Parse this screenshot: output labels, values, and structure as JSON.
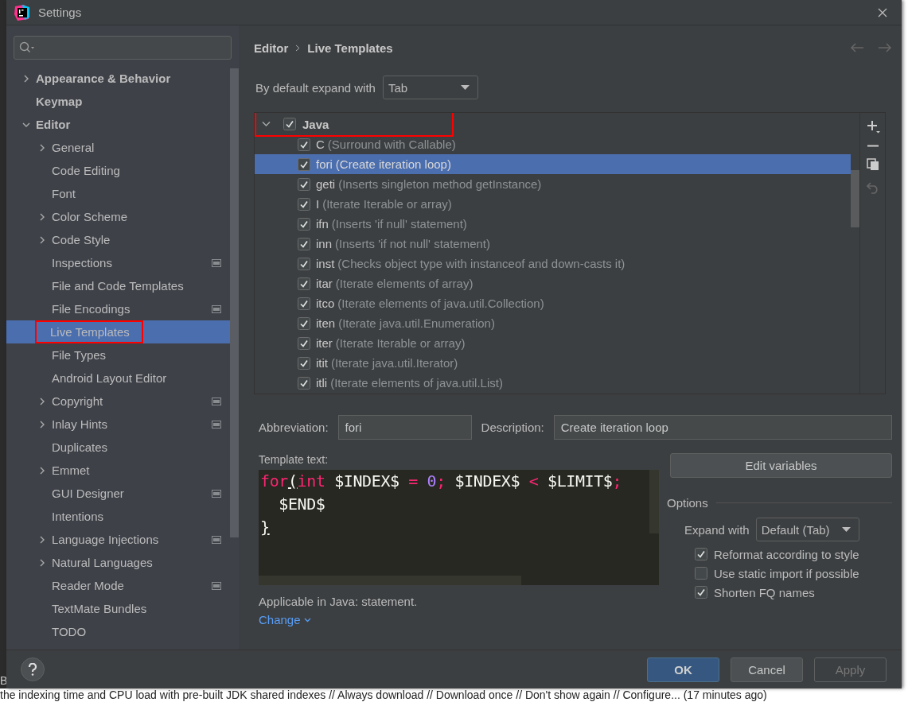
{
  "window": {
    "title": "Settings"
  },
  "sidebar": {
    "items": [
      {
        "label": "Appearance & Behavior",
        "expanded": false,
        "badge": false,
        "selected": false,
        "annotated": false
      },
      {
        "label": "Keymap",
        "badge": false,
        "selected": false,
        "annotated": false
      },
      {
        "label": "Editor",
        "expanded": true,
        "badge": false,
        "selected": false,
        "annotated": false,
        "children": [
          {
            "label": "General",
            "expanded": false,
            "badge": false,
            "selected": false,
            "annotated": false
          },
          {
            "label": "Code Editing",
            "badge": false,
            "selected": false,
            "annotated": false
          },
          {
            "label": "Font",
            "badge": false,
            "selected": false,
            "annotated": false
          },
          {
            "label": "Color Scheme",
            "expanded": false,
            "badge": false,
            "selected": false,
            "annotated": false
          },
          {
            "label": "Code Style",
            "expanded": false,
            "badge": false,
            "selected": false,
            "annotated": false
          },
          {
            "label": "Inspections",
            "badge": true,
            "selected": false,
            "annotated": false
          },
          {
            "label": "File and Code Templates",
            "badge": false,
            "selected": false,
            "annotated": false
          },
          {
            "label": "File Encodings",
            "badge": true,
            "selected": false,
            "annotated": false
          },
          {
            "label": "Live Templates",
            "badge": false,
            "selected": true,
            "annotated": true
          },
          {
            "label": "File Types",
            "badge": false,
            "selected": false,
            "annotated": false
          },
          {
            "label": "Android Layout Editor",
            "badge": false,
            "selected": false,
            "annotated": false
          },
          {
            "label": "Copyright",
            "expanded": false,
            "badge": true,
            "selected": false,
            "annotated": false
          },
          {
            "label": "Inlay Hints",
            "expanded": false,
            "badge": true,
            "selected": false,
            "annotated": false
          },
          {
            "label": "Duplicates",
            "badge": false,
            "selected": false,
            "annotated": false
          },
          {
            "label": "Emmet",
            "expanded": false,
            "badge": false,
            "selected": false,
            "annotated": false
          },
          {
            "label": "GUI Designer",
            "badge": true,
            "selected": false,
            "annotated": false
          },
          {
            "label": "Intentions",
            "badge": false,
            "selected": false,
            "annotated": false
          },
          {
            "label": "Language Injections",
            "expanded": false,
            "badge": true,
            "selected": false,
            "annotated": false
          },
          {
            "label": "Natural Languages",
            "expanded": false,
            "badge": false,
            "selected": false,
            "annotated": false
          },
          {
            "label": "Reader Mode",
            "badge": true,
            "selected": false,
            "annotated": false
          },
          {
            "label": "TextMate Bundles",
            "badge": false,
            "selected": false,
            "annotated": false
          },
          {
            "label": "TODO",
            "badge": false,
            "selected": false,
            "annotated": false
          }
        ]
      }
    ]
  },
  "breadcrumb": [
    "Editor",
    "Live Templates"
  ],
  "expand_with": {
    "label": "By default expand with",
    "value": "Tab"
  },
  "templates": [
    {
      "label": "Java",
      "checked": true,
      "expanded": true,
      "annotated": true,
      "children": [
        {
          "abbreviation": "C",
          "description": "(Surround with Callable)",
          "checked": true,
          "selected": false
        },
        {
          "abbreviation": "fori",
          "description": "(Create iteration loop)",
          "checked": true,
          "selected": true
        },
        {
          "abbreviation": "geti",
          "description": "(Inserts singleton method getInstance)",
          "checked": true,
          "selected": false
        },
        {
          "abbreviation": "I",
          "description": "(Iterate Iterable or array)",
          "checked": true,
          "selected": false
        },
        {
          "abbreviation": "ifn",
          "description": "(Inserts 'if null' statement)",
          "checked": true,
          "selected": false
        },
        {
          "abbreviation": "inn",
          "description": "(Inserts 'if not null' statement)",
          "checked": true,
          "selected": false
        },
        {
          "abbreviation": "inst",
          "description": "(Checks object type with instanceof and down-casts it)",
          "checked": true,
          "selected": false
        },
        {
          "abbreviation": "itar",
          "description": "(Iterate elements of array)",
          "checked": true,
          "selected": false
        },
        {
          "abbreviation": "itco",
          "description": "(Iterate elements of java.util.Collection)",
          "checked": true,
          "selected": false
        },
        {
          "abbreviation": "iten",
          "description": "(Iterate java.util.Enumeration)",
          "checked": true,
          "selected": false
        },
        {
          "abbreviation": "iter",
          "description": "(Iterate Iterable or array)",
          "checked": true,
          "selected": false
        },
        {
          "abbreviation": "itit",
          "description": "(Iterate java.util.Iterator)",
          "checked": true,
          "selected": false
        },
        {
          "abbreviation": "itli",
          "description": "(Iterate elements of java.util.List)",
          "checked": true,
          "selected": false
        }
      ]
    }
  ],
  "toolbar": [
    {
      "kind": "add",
      "disabled": false
    },
    {
      "kind": "remove",
      "disabled": false
    },
    {
      "kind": "copy",
      "disabled": false
    },
    {
      "kind": "undo",
      "disabled": true
    }
  ],
  "abbreviation": {
    "label": "Abbreviation:",
    "value": "fori"
  },
  "description": {
    "label": "Description:",
    "value": "Create iteration loop"
  },
  "template_text": {
    "label": "Template text:",
    "lines": [
      [
        {
          "kind": "keyword",
          "text": "for"
        },
        {
          "kind": "match",
          "text": "("
        },
        {
          "kind": "keyword",
          "text": "int"
        },
        {
          "kind": "plain",
          "text": " $INDEX$ "
        },
        {
          "kind": "keyword",
          "text": "= "
        },
        {
          "kind": "number",
          "text": "0"
        },
        {
          "kind": "keyword",
          "text": ";"
        },
        {
          "kind": "plain",
          "text": " $INDEX$ "
        },
        {
          "kind": "keyword",
          "text": "<"
        },
        {
          "kind": "plain",
          "text": " $LIMIT$"
        },
        {
          "kind": "keyword",
          "text": ";"
        }
      ],
      [
        {
          "kind": "plain",
          "text": "  $END$"
        }
      ],
      [
        {
          "kind": "match",
          "text": "}"
        }
      ]
    ]
  },
  "edit_variables": "Edit variables",
  "options": {
    "title": "Options",
    "expand_label": "Expand with",
    "expand_value": "Default (Tab)",
    "checkboxes": [
      {
        "label": "Reformat according to style",
        "checked": true
      },
      {
        "label": "Use static import if possible",
        "checked": false
      },
      {
        "label": "Shorten FQ names",
        "checked": true
      }
    ]
  },
  "applicable": "Applicable in Java: statement.",
  "change_link": "Change",
  "buttons": [
    {
      "label": "OK",
      "kind": "primary",
      "disabled": false
    },
    {
      "label": "Cancel",
      "kind": "normal",
      "disabled": false
    },
    {
      "label": "Apply",
      "kind": "normal",
      "disabled": true
    }
  ],
  "background": {
    "edge_text": "B",
    "notification": "the indexing time and CPU load with pre-built JDK shared indexes // Always download // Download once // Don't show again // Configure... (17 minutes ago)"
  }
}
